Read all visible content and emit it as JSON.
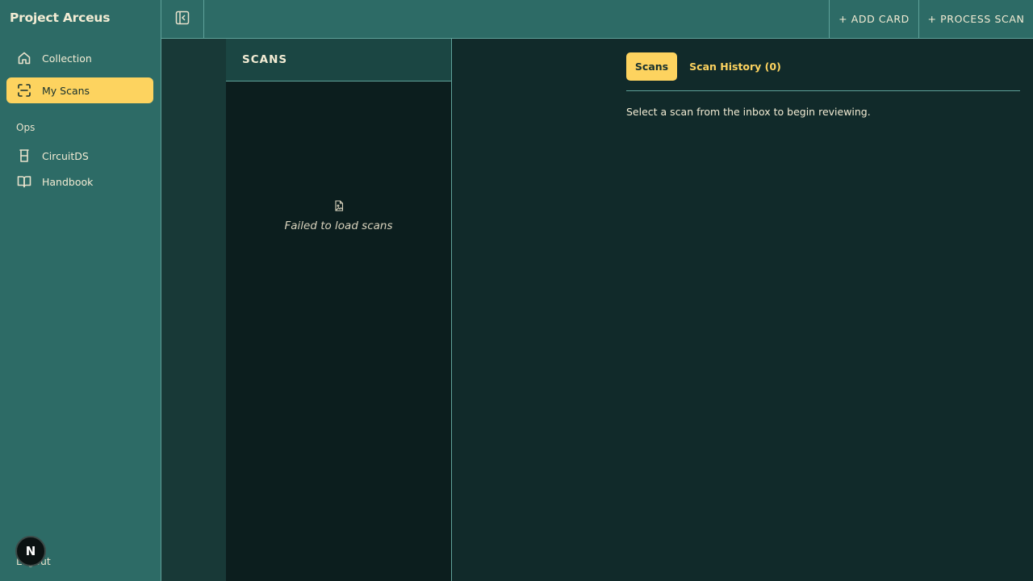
{
  "app": {
    "title": "Project Arceus"
  },
  "sidebar": {
    "items": [
      {
        "label": "Collection",
        "icon": "home-icon",
        "active": false
      },
      {
        "label": "My Scans",
        "icon": "scan-icon",
        "active": true
      }
    ],
    "ops_section_label": "Ops",
    "ops_items": [
      {
        "label": "CircuitDS",
        "icon": "beaker-icon"
      },
      {
        "label": "Handbook",
        "icon": "book-icon"
      }
    ],
    "logout_label": "Logout",
    "avatar_letter": "N"
  },
  "topbar": {
    "collapse_icon": "sidebar-collapse-icon",
    "add_card_label": "+ ADD CARD",
    "process_scan_label": "+ PROCESS SCAN"
  },
  "scans_panel": {
    "title": "SCANS",
    "empty_icon": "file-image-icon",
    "empty_message": "Failed to load scans"
  },
  "main": {
    "tabs": [
      {
        "label": "Scans",
        "active": true
      },
      {
        "label": "Scan History (0)",
        "active": false
      }
    ],
    "message": "Select a scan from the inbox to begin reviewing."
  },
  "colors": {
    "sidebar_bg": "#2d6b66",
    "accent": "#fdd35f",
    "content_bg": "#112a2a",
    "panel_bg": "#0c1e1e",
    "border": "#5fa29a"
  }
}
